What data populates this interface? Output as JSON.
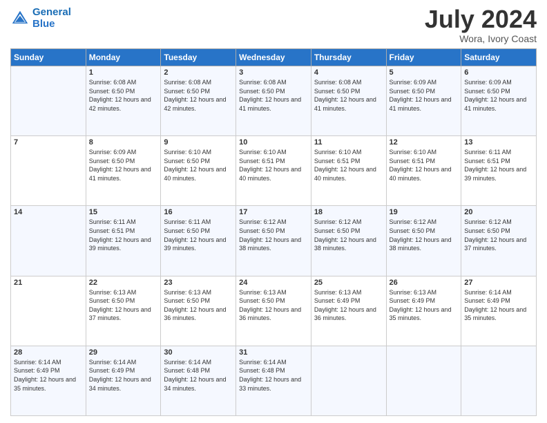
{
  "header": {
    "logo_line1": "General",
    "logo_line2": "Blue",
    "month": "July 2024",
    "location": "Wora, Ivory Coast"
  },
  "weekdays": [
    "Sunday",
    "Monday",
    "Tuesday",
    "Wednesday",
    "Thursday",
    "Friday",
    "Saturday"
  ],
  "weeks": [
    [
      {
        "day": "",
        "info": ""
      },
      {
        "day": "1",
        "info": "Sunrise: 6:08 AM\nSunset: 6:50 PM\nDaylight: 12 hours\nand 42 minutes."
      },
      {
        "day": "2",
        "info": "Sunrise: 6:08 AM\nSunset: 6:50 PM\nDaylight: 12 hours\nand 42 minutes."
      },
      {
        "day": "3",
        "info": "Sunrise: 6:08 AM\nSunset: 6:50 PM\nDaylight: 12 hours\nand 41 minutes."
      },
      {
        "day": "4",
        "info": "Sunrise: 6:08 AM\nSunset: 6:50 PM\nDaylight: 12 hours\nand 41 minutes."
      },
      {
        "day": "5",
        "info": "Sunrise: 6:09 AM\nSunset: 6:50 PM\nDaylight: 12 hours\nand 41 minutes."
      },
      {
        "day": "6",
        "info": "Sunrise: 6:09 AM\nSunset: 6:50 PM\nDaylight: 12 hours\nand 41 minutes."
      }
    ],
    [
      {
        "day": "7",
        "info": ""
      },
      {
        "day": "8",
        "info": "Sunrise: 6:09 AM\nSunset: 6:50 PM\nDaylight: 12 hours\nand 41 minutes."
      },
      {
        "day": "9",
        "info": "Sunrise: 6:10 AM\nSunset: 6:50 PM\nDaylight: 12 hours\nand 40 minutes."
      },
      {
        "day": "10",
        "info": "Sunrise: 6:10 AM\nSunset: 6:51 PM\nDaylight: 12 hours\nand 40 minutes."
      },
      {
        "day": "11",
        "info": "Sunrise: 6:10 AM\nSunset: 6:51 PM\nDaylight: 12 hours\nand 40 minutes."
      },
      {
        "day": "12",
        "info": "Sunrise: 6:10 AM\nSunset: 6:51 PM\nDaylight: 12 hours\nand 40 minutes."
      },
      {
        "day": "13",
        "info": "Sunrise: 6:11 AM\nSunset: 6:51 PM\nDaylight: 12 hours\nand 39 minutes."
      }
    ],
    [
      {
        "day": "14",
        "info": ""
      },
      {
        "day": "15",
        "info": "Sunrise: 6:11 AM\nSunset: 6:51 PM\nDaylight: 12 hours\nand 39 minutes."
      },
      {
        "day": "16",
        "info": "Sunrise: 6:11 AM\nSunset: 6:50 PM\nDaylight: 12 hours\nand 39 minutes."
      },
      {
        "day": "17",
        "info": "Sunrise: 6:12 AM\nSunset: 6:50 PM\nDaylight: 12 hours\nand 38 minutes."
      },
      {
        "day": "18",
        "info": "Sunrise: 6:12 AM\nSunset: 6:50 PM\nDaylight: 12 hours\nand 38 minutes."
      },
      {
        "day": "19",
        "info": "Sunrise: 6:12 AM\nSunset: 6:50 PM\nDaylight: 12 hours\nand 38 minutes."
      },
      {
        "day": "20",
        "info": "Sunrise: 6:12 AM\nSunset: 6:50 PM\nDaylight: 12 hours\nand 37 minutes."
      }
    ],
    [
      {
        "day": "21",
        "info": ""
      },
      {
        "day": "22",
        "info": "Sunrise: 6:13 AM\nSunset: 6:50 PM\nDaylight: 12 hours\nand 37 minutes."
      },
      {
        "day": "23",
        "info": "Sunrise: 6:13 AM\nSunset: 6:50 PM\nDaylight: 12 hours\nand 36 minutes."
      },
      {
        "day": "24",
        "info": "Sunrise: 6:13 AM\nSunset: 6:50 PM\nDaylight: 12 hours\nand 36 minutes."
      },
      {
        "day": "25",
        "info": "Sunrise: 6:13 AM\nSunset: 6:49 PM\nDaylight: 12 hours\nand 36 minutes."
      },
      {
        "day": "26",
        "info": "Sunrise: 6:13 AM\nSunset: 6:49 PM\nDaylight: 12 hours\nand 35 minutes."
      },
      {
        "day": "27",
        "info": "Sunrise: 6:14 AM\nSunset: 6:49 PM\nDaylight: 12 hours\nand 35 minutes."
      }
    ],
    [
      {
        "day": "28",
        "info": "Sunrise: 6:14 AM\nSunset: 6:49 PM\nDaylight: 12 hours\nand 35 minutes."
      },
      {
        "day": "29",
        "info": "Sunrise: 6:14 AM\nSunset: 6:49 PM\nDaylight: 12 hours\nand 34 minutes."
      },
      {
        "day": "30",
        "info": "Sunrise: 6:14 AM\nSunset: 6:48 PM\nDaylight: 12 hours\nand 34 minutes."
      },
      {
        "day": "31",
        "info": "Sunrise: 6:14 AM\nSunset: 6:48 PM\nDaylight: 12 hours\nand 33 minutes."
      },
      {
        "day": "",
        "info": ""
      },
      {
        "day": "",
        "info": ""
      },
      {
        "day": "",
        "info": ""
      }
    ]
  ]
}
